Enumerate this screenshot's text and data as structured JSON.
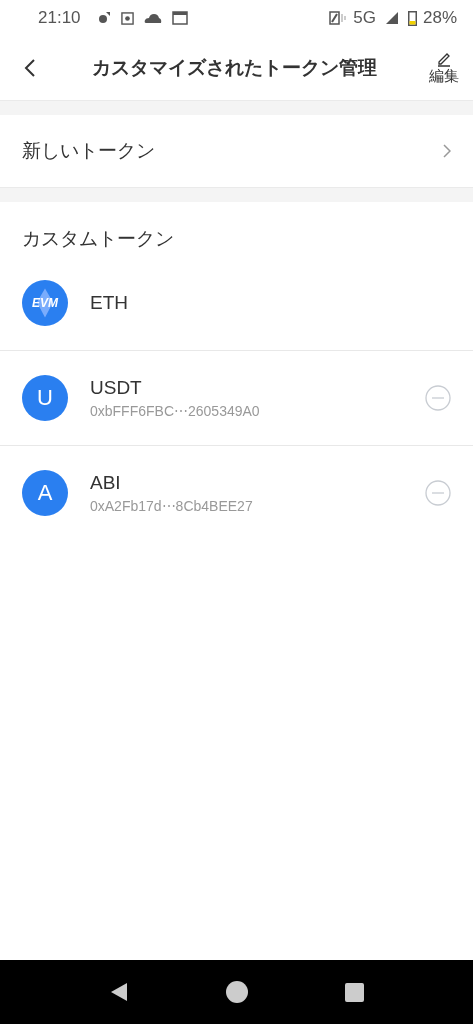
{
  "status_bar": {
    "time": "21:10",
    "network": "5G",
    "battery": "28%"
  },
  "header": {
    "title": "カスタマイズされたトークン管理",
    "edit_label": "編集"
  },
  "new_token": {
    "label": "新しいトークン"
  },
  "section_title": "カスタムトークン",
  "tokens": [
    {
      "kind": "evm",
      "badge": "EVM",
      "name": "ETH",
      "removable": false
    },
    {
      "kind": "letter",
      "badge": "U",
      "name": "USDT",
      "address": "0xbFFF6FBC⋯2605349A0",
      "removable": true
    },
    {
      "kind": "letter",
      "badge": "A",
      "name": "ABI",
      "address": "0xA2Fb17d⋯8Cb4BEE27",
      "removable": true
    }
  ]
}
